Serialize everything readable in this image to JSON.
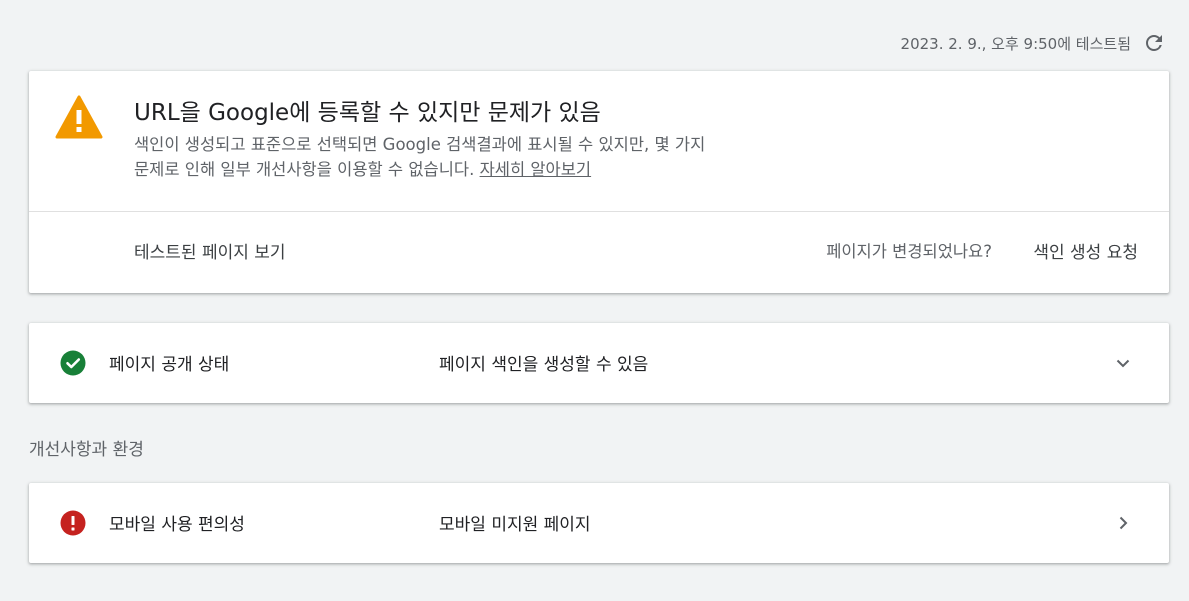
{
  "header": {
    "tested_at": "2023. 2. 9., 오후 9:50에 테스트됨",
    "refresh_icon": "refresh-icon"
  },
  "status": {
    "icon": "warning-icon",
    "icon_color": "#f29900",
    "title": "URL을 Google에 등록할 수 있지만 문제가 있음",
    "desc_line1": "색인이 생성되고 표준으로 선택되면 Google 검색결과에 표시될 수 있지만, 몇 가지",
    "desc_line2": "문제로 인해 일부 개선사항을 이용할 수 없습니다.",
    "learn_more": "자세히 알아보기",
    "view_tested_page": "테스트된 페이지 보기",
    "page_changed_question": "페이지가 변경되었나요?",
    "request_indexing": "색인 생성 요청"
  },
  "availability": {
    "icon": "check-circle-icon",
    "icon_color": "#188038",
    "label": "페이지 공개 상태",
    "value": "페이지 색인을 생성할 수 있음",
    "chevron": "chevron-down-icon"
  },
  "enhancements": {
    "heading": "개선사항과 환경",
    "items": [
      {
        "icon": "error-circle-icon",
        "icon_color": "#c5221f",
        "label": "모바일 사용 편의성",
        "value": "모바일 미지원 페이지",
        "chevron": "chevron-right-icon"
      }
    ]
  }
}
